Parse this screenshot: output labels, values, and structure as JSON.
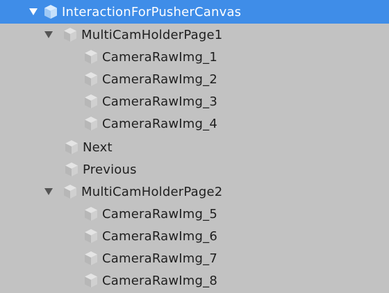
{
  "colors": {
    "background": "#c2c2c2",
    "selection": "#3f8de8",
    "text": "#1f1f1f",
    "selected_text": "#ffffff"
  },
  "root": {
    "label": "InteractionForPusherCanvas",
    "expanded": true,
    "selected": true
  },
  "page1": {
    "label": "MultiCamHolderPage1",
    "expanded": true,
    "children": [
      "CameraRawImg_1",
      "CameraRawImg_2",
      "CameraRawImg_3",
      "CameraRawImg_4"
    ]
  },
  "next": {
    "label": "Next"
  },
  "previous": {
    "label": "Previous"
  },
  "page2": {
    "label": "MultiCamHolderPage2",
    "expanded": true,
    "children": [
      "CameraRawImg_5",
      "CameraRawImg_6",
      "CameraRawImg_7",
      "CameraRawImg_8"
    ]
  }
}
